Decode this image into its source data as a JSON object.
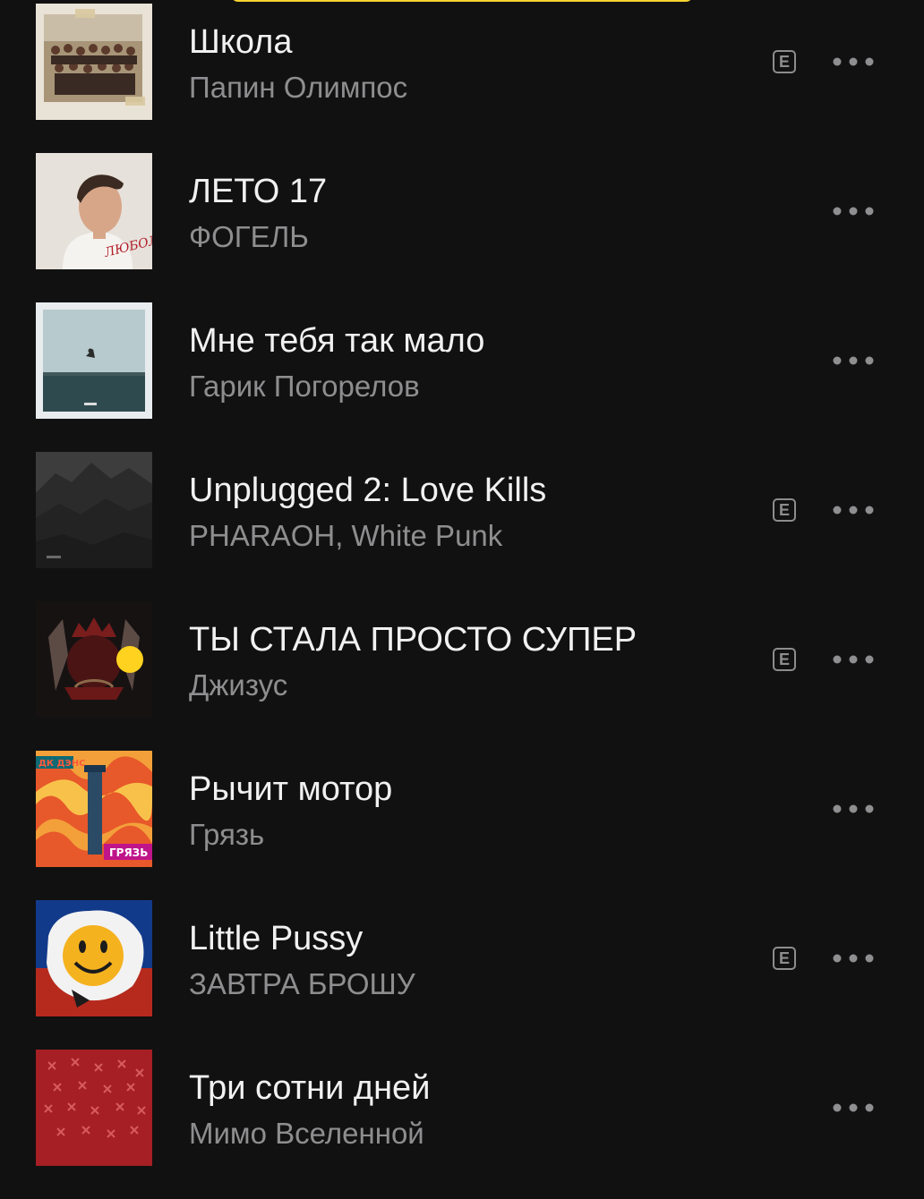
{
  "accent_color": "#f7d32f",
  "tracks": [
    {
      "title": "Школа",
      "artist": "Папин Олимпос",
      "explicit": true,
      "explicit_label": "E",
      "more_icon": "more-horizontal-icon",
      "cover": "school-class-photo"
    },
    {
      "title": "ЛЕТО 17",
      "artist": "ФОГЕЛЬ",
      "explicit": false,
      "more_icon": "more-horizontal-icon",
      "cover": "boy-portrait"
    },
    {
      "title": "Мне тебя так мало",
      "artist": "Гарик Погорелов",
      "explicit": false,
      "more_icon": "more-horizontal-icon",
      "cover": "sea-horizon"
    },
    {
      "title": "Unplugged 2: Love Kills",
      "artist": "PHARAOH, White Punk",
      "explicit": true,
      "explicit_label": "E",
      "more_icon": "more-horizontal-icon",
      "cover": "dark-mountains"
    },
    {
      "title": "ТЫ СТАЛА ПРОСТО СУПЕР",
      "artist": "Джизус",
      "explicit": true,
      "explicit_label": "E",
      "more_icon": "more-horizontal-icon",
      "cover": "dark-crest",
      "now_playing": true
    },
    {
      "title": "Рычит мотор",
      "artist": "Грязь",
      "explicit": false,
      "more_icon": "more-horizontal-icon",
      "cover": "fire-tower",
      "cover_text": [
        "ДК ДЭНС",
        "ГРЯЗЬ"
      ]
    },
    {
      "title": "Little Pussy",
      "artist": "ЗАВТРА БРОШУ",
      "explicit": true,
      "explicit_label": "E",
      "more_icon": "more-horizontal-icon",
      "cover": "smiley-face"
    },
    {
      "title": "Три сотни дней",
      "artist": "Мимо Вселенной",
      "explicit": false,
      "more_icon": "more-horizontal-icon",
      "cover": "red-crosses"
    }
  ]
}
